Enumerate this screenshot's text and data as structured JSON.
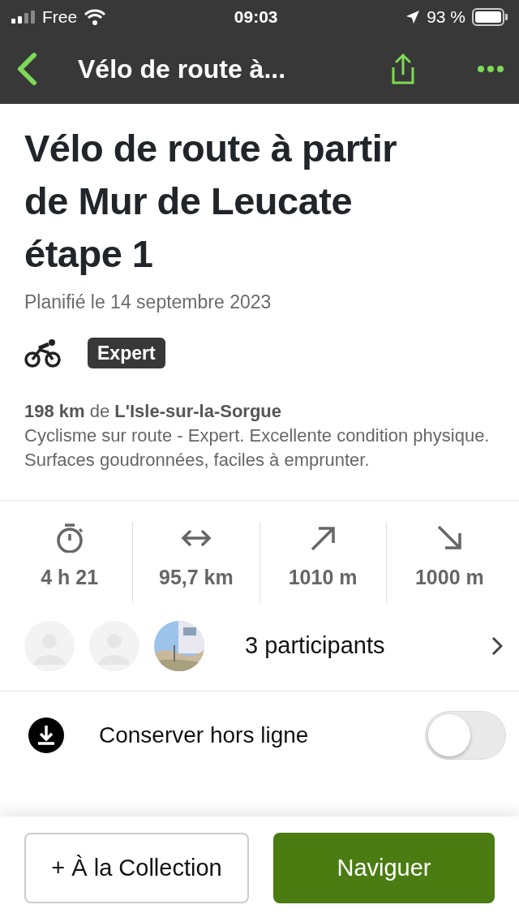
{
  "status_bar": {
    "carrier": "Free",
    "time": "09:03",
    "battery": "93 %"
  },
  "nav": {
    "title": "Vélo de route à..."
  },
  "tour": {
    "title": "Vélo de route à partir de Mur de Leucate étape 1",
    "planned": "Planifié le 14 septembre 2023",
    "difficulty": "Expert",
    "summary": "**198 km** de **L'Isle-sur-la-Sorgue**",
    "description": "Cyclisme sur route - Expert. Excellente condition physique. Surfaces goudronnées, faciles à emprunter."
  },
  "stats": [
    {
      "kind": "duration",
      "value": "4 h 21"
    },
    {
      "kind": "distance",
      "value": "95,7 km"
    },
    {
      "kind": "ascent",
      "value": "1010 m"
    },
    {
      "kind": "descent",
      "value": "1000 m"
    }
  ],
  "participants": {
    "avatars": [
      {
        "kind": "placeholder"
      },
      {
        "kind": "placeholder"
      },
      {
        "kind": "picture"
      }
    ],
    "label": "3 participants"
  },
  "offline": {
    "label": "Conserver hors ligne",
    "on": false
  },
  "buttons": {
    "collection": "+ À la Collection",
    "navigate": "Naviguer"
  }
}
